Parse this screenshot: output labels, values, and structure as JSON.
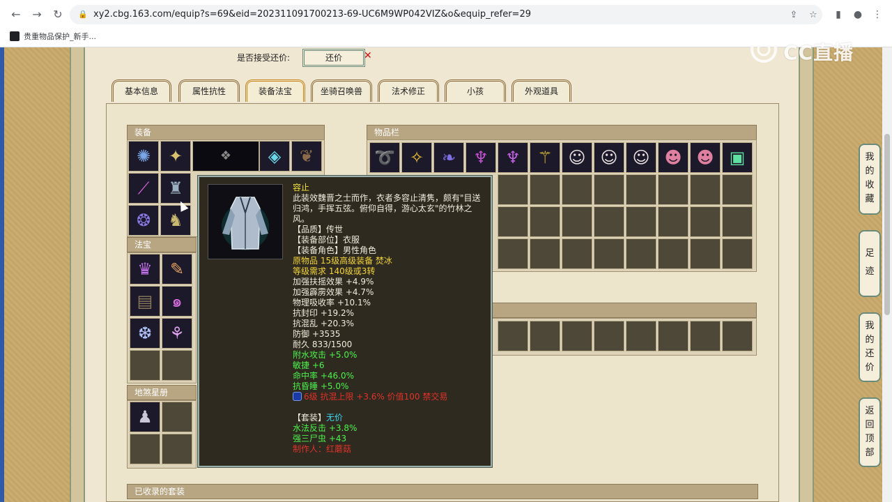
{
  "browser": {
    "url": "xy2.cbg.163.com/equip?s=69&eid=202311091700213-69-UC6M9WP042VIZ&o&equip_refer=29",
    "bookmark": "贵重物品保护_新手..."
  },
  "watermark": "CC直播",
  "bargain": {
    "label": "是否接受还价:",
    "button": "还价"
  },
  "tabs": [
    "基本信息",
    "属性抗性",
    "装备法宝",
    "坐骑召唤兽",
    "法术修正",
    "小孩",
    "外观道具"
  ],
  "sections": {
    "equipment": "装备",
    "fabao": "法宝",
    "dishaxingce": "地煞星册",
    "inventory": "物品栏",
    "collected_sets": "已收录的套装"
  },
  "tooltip": {
    "name": "容止",
    "desc": [
      "此装效魏晋之士而作，衣者多容止清隽，颇有\"目送",
      "归鸿，手挥五弦。俯仰自得，游心太玄\"的竹林之",
      "风。"
    ],
    "quality": "【品质】传世",
    "slot": "【装备部位】衣服",
    "role": "【装备角色】男性角色",
    "origin": "原物品 15级高级装备 焚冰",
    "level_req": "等级需求 140级或3转",
    "stats_white": [
      "加强扶摇效果 +4.9%",
      "加强霹雳效果 +4.7%",
      "物理吸收率 +10.1%",
      "抗封印 +19.2%",
      "抗混乱 +20.3%",
      "防御 +3535",
      "耐久 833/1500"
    ],
    "stats_green": [
      "附水攻击 +5.0%",
      "敏捷 +6",
      "命中率 +46.0%",
      "抗昏睡 +5.0%"
    ],
    "gem": "6级 抗混上限 +3.6% 价值100 禁交易",
    "set_label": "【套装】",
    "set_name": "无价",
    "set_stats": [
      "水法反击 +3.8%",
      "强三尸虫 +43"
    ],
    "maker": "制作人：红蘑菇"
  },
  "side_buttons": [
    [
      "我",
      "的",
      "收",
      "藏"
    ],
    [
      "足",
      "迹"
    ],
    [
      "我",
      "的",
      "还",
      "价"
    ],
    [
      "返",
      "回",
      "顶",
      "部"
    ]
  ],
  "colors": {
    "page_bg": "#c9a96a",
    "panel_bg": "#ece4cb",
    "tooltip_bg": "#2e2a1f",
    "section_head": "#b8a582",
    "stat_white": "#f0ecdc",
    "stat_green": "#4cf24c",
    "stat_red": "#e0322a",
    "title_yellow": "#f4e23a"
  }
}
